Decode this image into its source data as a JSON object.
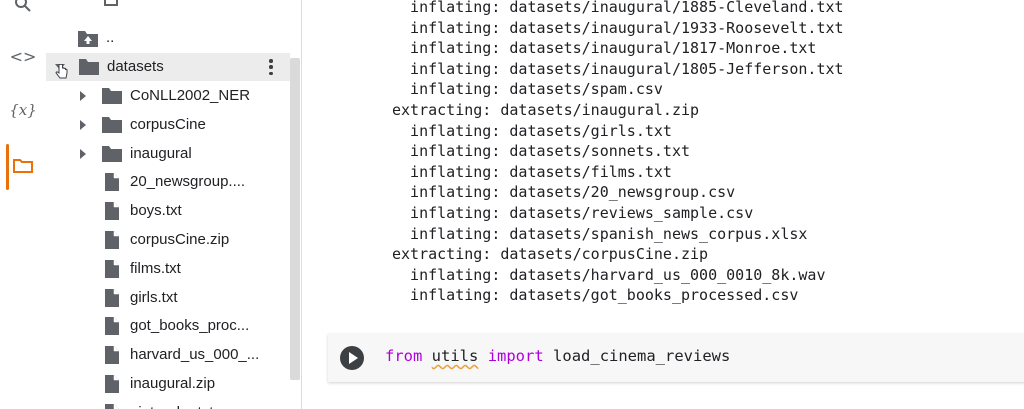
{
  "rail": {
    "items": [
      {
        "icon": "code-icon",
        "glyph": "<>"
      },
      {
        "icon": "variables-icon",
        "glyph": "{x}"
      },
      {
        "icon": "folder-icon",
        "glyph": ""
      }
    ],
    "accent": "#e8710a"
  },
  "files": {
    "parent_label": "..",
    "root": {
      "label": "datasets",
      "expanded": true
    },
    "items": [
      {
        "label": "CoNLL2002_NER",
        "type": "folder"
      },
      {
        "label": "corpusCine",
        "type": "folder"
      },
      {
        "label": "inaugural",
        "type": "folder"
      },
      {
        "label": "20_newsgroup....",
        "type": "file"
      },
      {
        "label": "boys.txt",
        "type": "file"
      },
      {
        "label": "corpusCine.zip",
        "type": "file"
      },
      {
        "label": "films.txt",
        "type": "file"
      },
      {
        "label": "girls.txt",
        "type": "file"
      },
      {
        "label": "got_books_proc...",
        "type": "file"
      },
      {
        "label": "harvard_us_000_...",
        "type": "file"
      },
      {
        "label": "inaugural.zip",
        "type": "file"
      },
      {
        "label": "nietzsche.txt",
        "type": "file"
      }
    ]
  },
  "output": {
    "lines": [
      "  inflating: datasets/inaugural/1885-Cleveland.txt",
      "  inflating: datasets/inaugural/1933-Roosevelt.txt",
      "  inflating: datasets/inaugural/1817-Monroe.txt",
      "  inflating: datasets/inaugural/1805-Jefferson.txt",
      "  inflating: datasets/spam.csv",
      "extracting: datasets/inaugural.zip",
      "  inflating: datasets/girls.txt",
      "  inflating: datasets/sonnets.txt",
      "  inflating: datasets/films.txt",
      "  inflating: datasets/20_newsgroup.csv",
      "  inflating: datasets/reviews_sample.csv",
      "  inflating: datasets/spanish_news_corpus.xlsx",
      "extracting: datasets/corpusCine.zip",
      "  inflating: datasets/harvard_us_000_0010_8k.wav",
      "  inflating: datasets/got_books_processed.csv"
    ]
  },
  "cell": {
    "kw_from": "from",
    "module": "utils",
    "kw_import": "import",
    "name": "load_cinema_reviews",
    "keyword_color": "#af00db"
  }
}
